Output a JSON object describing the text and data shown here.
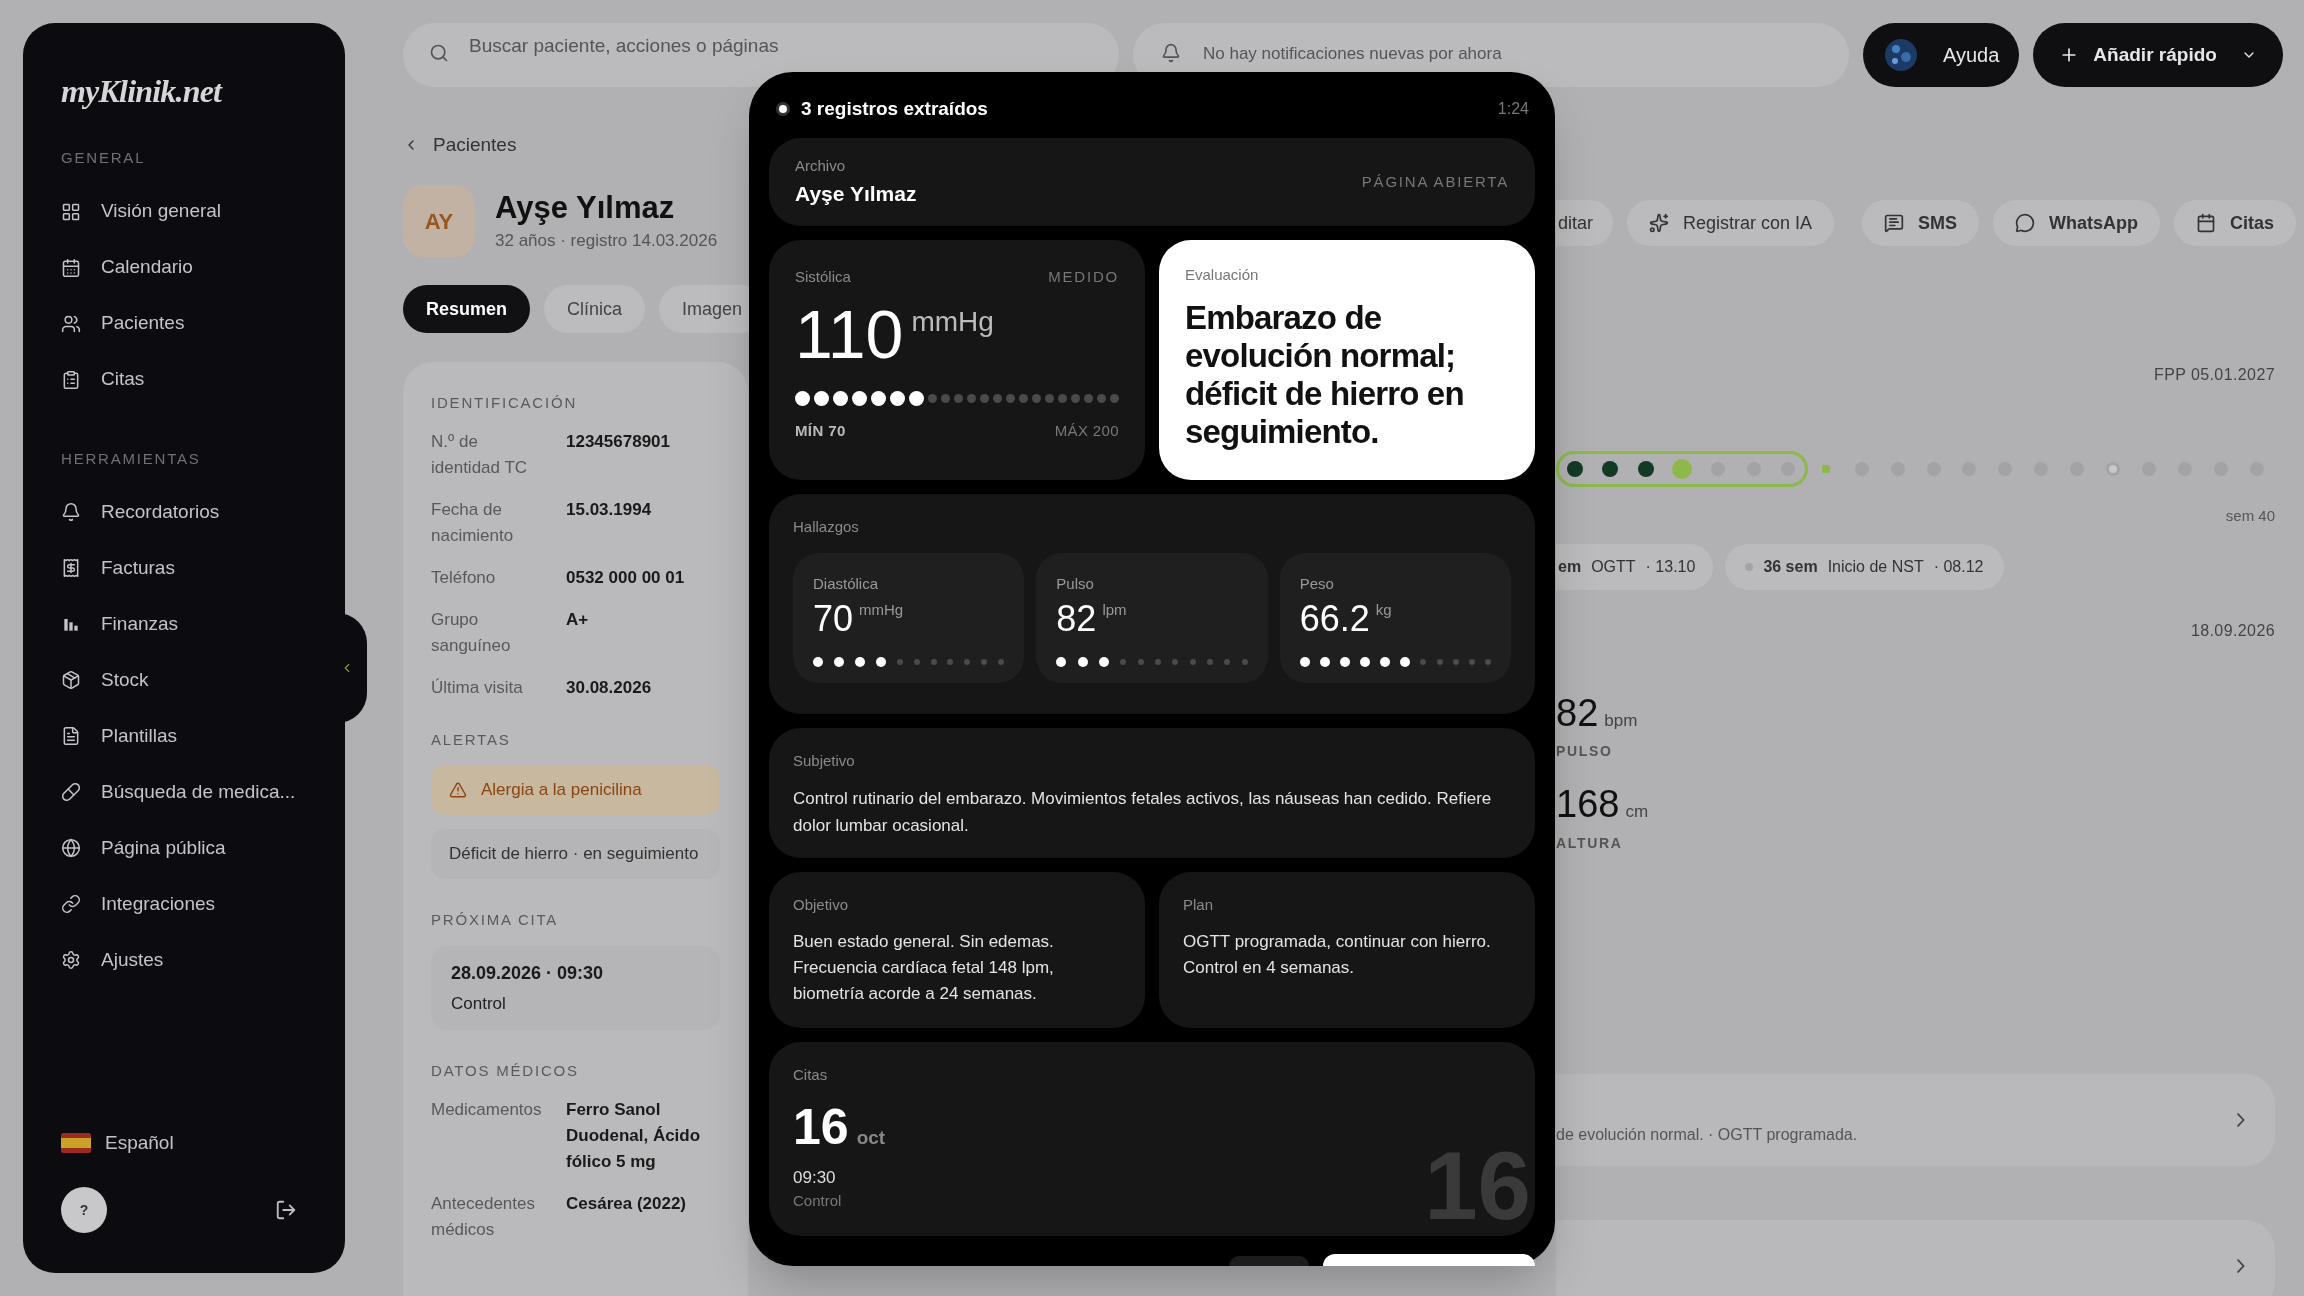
{
  "sidebar": {
    "logo": "myKlinik.net",
    "sections": [
      {
        "heading": "GENERAL",
        "items": [
          {
            "label": "Visión general",
            "selected": false
          },
          {
            "label": "Calendario",
            "selected": false
          },
          {
            "label": "Pacientes",
            "selected": false
          },
          {
            "label": "Citas",
            "selected": false
          }
        ]
      },
      {
        "heading": "HERRAMIENTAS",
        "items": [
          {
            "label": "Recordatorios",
            "selected": false
          },
          {
            "label": "Facturas",
            "selected": false
          },
          {
            "label": "Finanzas",
            "selected": false
          },
          {
            "label": "Stock",
            "selected": false
          },
          {
            "label": "Plantillas",
            "selected": false
          },
          {
            "label": "Búsqueda de medica...",
            "selected": false
          },
          {
            "label": "Página pública",
            "selected": false
          },
          {
            "label": "Integraciones",
            "selected": false
          },
          {
            "label": "Ajustes",
            "selected": false
          }
        ]
      }
    ],
    "language": "Español",
    "help": "?"
  },
  "topbar": {
    "search_placeholder": "Buscar paciente, acciones o páginas",
    "notifications": "No hay notificaciones nuevas por ahora",
    "help_button": "Ayuda",
    "quick_add": "Añadir rápido"
  },
  "patient": {
    "back": "Pacientes",
    "initials": "AY",
    "name": "Ayşe Yılmaz",
    "subtitle": "32 años · registro 14.03.2026",
    "tabs": [
      {
        "label": "Resumen",
        "selected": true
      },
      {
        "label": "Clínica",
        "selected": false
      },
      {
        "label": "Imagen",
        "selected": false
      }
    ],
    "identification": {
      "heading": "IDENTIFICACIÓN",
      "rows": [
        {
          "label": "N.º de identidad TC",
          "value": "12345678901"
        },
        {
          "label": "Fecha de nacimiento",
          "value": "15.03.1994"
        },
        {
          "label": "Teléfono",
          "value": "0532 000 00 01"
        },
        {
          "label": "Grupo sanguíneo",
          "value": "A+"
        },
        {
          "label": "Última visita",
          "value": "30.08.2026"
        }
      ]
    },
    "alerts": {
      "heading": "ALERTAS",
      "items": [
        {
          "text": "Alergia a la penicilina",
          "kind": "warning"
        },
        {
          "text": "Déficit de hierro · en seguimiento",
          "kind": "note"
        }
      ]
    },
    "next_appointment": {
      "heading": "PRÓXIMA CITA",
      "when": "28.09.2026 · 09:30",
      "type": "Control"
    },
    "medical": {
      "heading": "DATOS MÉDICOS",
      "rows": [
        {
          "label": "Medicamentos",
          "value": "Ferro Sanol Duodenal, Ácido fólico 5 mg"
        },
        {
          "label": "Antecedentes médicos",
          "value": "Cesárea (2022)"
        }
      ]
    }
  },
  "actions": [
    {
      "label": "ditar"
    },
    {
      "label": "Registrar con IA"
    },
    {
      "label": "SMS"
    },
    {
      "label": "WhatsApp"
    },
    {
      "label": "Citas"
    }
  ],
  "pregnancy": {
    "due": "FPP 05.01.2027",
    "end_label": "sem 40",
    "weeks": [
      {
        "kind": "past",
        "highlighted": true
      },
      {
        "kind": "past",
        "highlighted": true
      },
      {
        "kind": "past",
        "highlighted": true
      },
      {
        "kind": "current",
        "highlighted": true
      },
      {
        "kind": "future",
        "highlighted": true
      },
      {
        "kind": "future",
        "highlighted": true
      },
      {
        "kind": "future",
        "highlighted": true
      },
      {
        "kind": "next",
        "highlighted": false
      },
      {
        "kind": "future",
        "highlighted": false
      },
      {
        "kind": "future",
        "highlighted": false
      },
      {
        "kind": "future",
        "highlighted": false
      },
      {
        "kind": "future",
        "highlighted": false
      },
      {
        "kind": "future",
        "highlighted": false
      },
      {
        "kind": "future",
        "highlighted": false
      },
      {
        "kind": "future",
        "highlighted": false
      },
      {
        "kind": "milestone",
        "highlighted": false
      },
      {
        "kind": "future",
        "highlighted": false
      },
      {
        "kind": "future",
        "highlighted": false
      },
      {
        "kind": "future",
        "highlighted": false
      },
      {
        "kind": "future",
        "highlighted": false
      }
    ],
    "milestones": [
      {
        "week": "em",
        "title": "OGTT",
        "date": "· 13.10",
        "marker": false
      },
      {
        "week": "36 sem",
        "title": "Inicio de NST",
        "date": "· 08.12",
        "marker": true
      }
    ]
  },
  "last_visit": {
    "date": "18.09.2026",
    "vitals": [
      {
        "value": "82",
        "unit": "bpm",
        "label": "PULSO"
      },
      {
        "value": "168",
        "unit": "cm",
        "label": "ALTURA"
      }
    ]
  },
  "notes": [
    {
      "kind": "summary",
      "text": "de evolución normal. · OGTT programada."
    },
    {
      "kind": "collapsed"
    }
  ],
  "dialog": {
    "status": "3 registros extraídos",
    "timer": "1:24",
    "file": {
      "label": "Archivo",
      "name": "Ayşe Yılmaz",
      "action": "PÁGINA ABIERTA"
    },
    "systolic": {
      "label": "Sistólica",
      "tag": "MEDIDO",
      "value": "110",
      "unit": "mmHg",
      "level": 0.31,
      "min": "MÍN 70",
      "max": "MÁX 200"
    },
    "assessment": {
      "label": "Evaluación",
      "text": "Embarazo de evolución normal; déficit de hierro en seguimiento."
    },
    "findings": {
      "label": "Hallazgos",
      "items": [
        {
          "label": "Diastólica",
          "value": "70",
          "unit": "mmHg",
          "level": 0.36
        },
        {
          "label": "Pulso",
          "value": "82",
          "unit": "lpm",
          "level": 0.27
        },
        {
          "label": "Peso",
          "value": "66.2",
          "unit": "kg",
          "level": 0.55
        }
      ]
    },
    "subjective": {
      "label": "Subjetivo",
      "text": "Control rutinario del embarazo. Movimientos fetales activos, las náuseas han cedido. Refiere dolor lumbar ocasional."
    },
    "objective": {
      "label": "Objetivo",
      "text": "Buen estado general. Sin edemas. Frecuencia cardíaca fetal 148 lpm, biometría acorde a 24 semanas."
    },
    "plan": {
      "label": "Plan",
      "text": "OGTT programada, continuar con hierro. Control en 4 semanas."
    },
    "appointment": {
      "label": "Citas",
      "day": "16",
      "month": "oct",
      "time": "09:30",
      "type": "Control",
      "backdrop": "16"
    }
  }
}
